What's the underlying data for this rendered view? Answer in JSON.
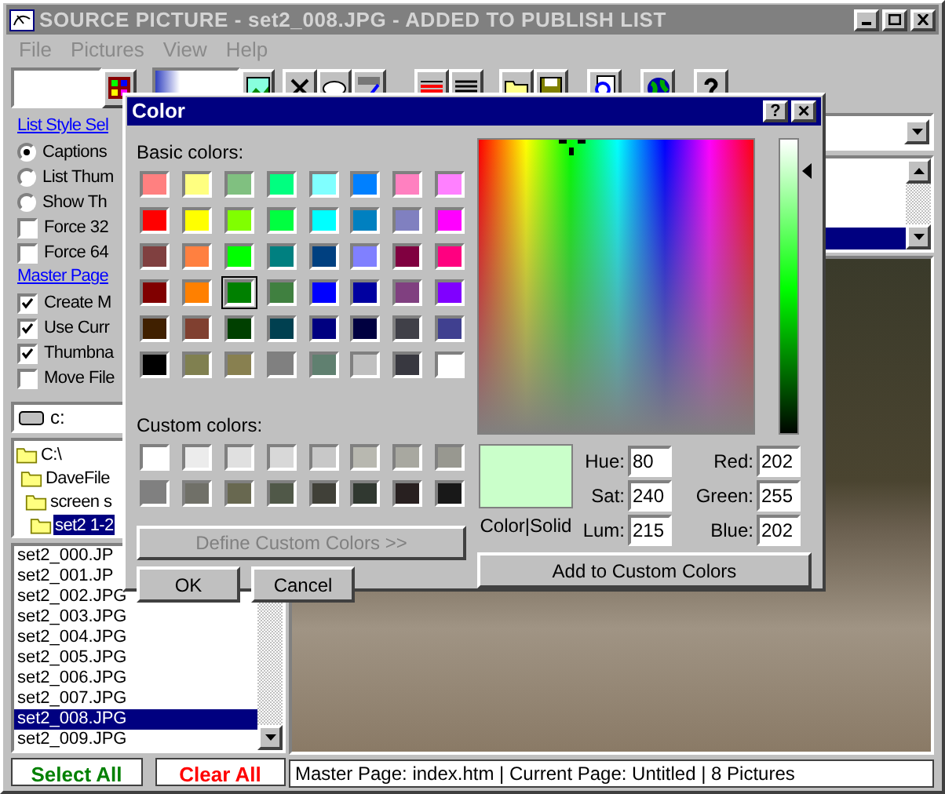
{
  "window": {
    "title": "SOURCE PICTURE - set2_008.JPG - ADDED TO PUBLISH LIST",
    "active": false
  },
  "menu": [
    "File",
    "Pictures",
    "View",
    "Help"
  ],
  "options": [
    {
      "kind": "link",
      "label": "List Style Sel"
    },
    {
      "kind": "radio",
      "label": "Captions",
      "selected": true
    },
    {
      "kind": "radio",
      "label": "List Thum",
      "selected": false
    },
    {
      "kind": "radio",
      "label": "Show Th",
      "selected": false
    },
    {
      "kind": "check",
      "label": "Force 32",
      "checked": false
    },
    {
      "kind": "check",
      "label": "Force 64",
      "checked": false
    },
    {
      "kind": "link",
      "label": "Master Page"
    },
    {
      "kind": "check",
      "label": "Create M",
      "checked": true
    },
    {
      "kind": "check",
      "label": "Use Curr",
      "checked": true
    },
    {
      "kind": "check",
      "label": "Thumbna",
      "checked": true
    },
    {
      "kind": "check",
      "label": "Move File",
      "checked": false
    }
  ],
  "drive": "c:",
  "folders": [
    {
      "label": "C:\\",
      "selected": false,
      "children": [
        {
          "label": "DaveFile",
          "selected": false,
          "children": [
            {
              "label": "screen s",
              "selected": false,
              "children": [
                {
                  "label": "set2 1-2",
                  "selected": true
                }
              ]
            }
          ]
        }
      ]
    }
  ],
  "files": [
    {
      "name": "set2_000.JP",
      "selected": false
    },
    {
      "name": "set2_001.JP",
      "selected": false
    },
    {
      "name": "set2_002.JPG",
      "selected": false
    },
    {
      "name": "set2_003.JPG",
      "selected": false
    },
    {
      "name": "set2_004.JPG",
      "selected": false
    },
    {
      "name": "set2_005.JPG",
      "selected": false
    },
    {
      "name": "set2_006.JPG",
      "selected": false
    },
    {
      "name": "set2_007.JPG",
      "selected": false
    },
    {
      "name": "set2_008.JPG",
      "selected": true
    },
    {
      "name": "set2_009.JPG",
      "selected": false
    }
  ],
  "buttons": {
    "select_all": "Select All",
    "clear_all": "Clear All"
  },
  "status_bar": "Master Page: index.htm | Current Page: Untitled | 8 Pictures",
  "color_dialog": {
    "title": "Color",
    "help": "?",
    "close": "×",
    "basic_label": "Basic colors:",
    "basic_colors": [
      {
        "color": "#ff8080",
        "selected": false
      },
      {
        "color": "#ffff80",
        "selected": false
      },
      {
        "color": "#80c080",
        "selected": false
      },
      {
        "color": "#00ff80",
        "selected": false
      },
      {
        "color": "#80ffff",
        "selected": false
      },
      {
        "color": "#0080ff",
        "selected": false
      },
      {
        "color": "#ff80c0",
        "selected": false
      },
      {
        "color": "#ff80ff",
        "selected": false
      },
      {
        "color": "#ff0000",
        "selected": false
      },
      {
        "color": "#ffff00",
        "selected": false
      },
      {
        "color": "#80ff00",
        "selected": false
      },
      {
        "color": "#00ff40",
        "selected": false
      },
      {
        "color": "#00ffff",
        "selected": false
      },
      {
        "color": "#0080c0",
        "selected": false
      },
      {
        "color": "#8080c0",
        "selected": false
      },
      {
        "color": "#ff00ff",
        "selected": false
      },
      {
        "color": "#804040",
        "selected": false
      },
      {
        "color": "#ff8040",
        "selected": false
      },
      {
        "color": "#00ff00",
        "selected": false
      },
      {
        "color": "#008080",
        "selected": false
      },
      {
        "color": "#004080",
        "selected": false
      },
      {
        "color": "#8080ff",
        "selected": false
      },
      {
        "color": "#800040",
        "selected": false
      },
      {
        "color": "#ff0080",
        "selected": false
      },
      {
        "color": "#800000",
        "selected": false
      },
      {
        "color": "#ff8000",
        "selected": false
      },
      {
        "color": "#008000",
        "selected": true
      },
      {
        "color": "#408040",
        "selected": false
      },
      {
        "color": "#0000ff",
        "selected": false
      },
      {
        "color": "#0000a0",
        "selected": false
      },
      {
        "color": "#804080",
        "selected": false
      },
      {
        "color": "#8000ff",
        "selected": false
      },
      {
        "color": "#402000",
        "selected": false
      },
      {
        "color": "#804030",
        "selected": false
      },
      {
        "color": "#004000",
        "selected": false
      },
      {
        "color": "#004050",
        "selected": false
      },
      {
        "color": "#000080",
        "selected": false
      },
      {
        "color": "#000040",
        "selected": false
      },
      {
        "color": "#404048",
        "selected": false
      },
      {
        "color": "#404090",
        "selected": false
      },
      {
        "color": "#000000",
        "selected": false
      },
      {
        "color": "#808050",
        "selected": false
      },
      {
        "color": "#888050",
        "selected": false
      },
      {
        "color": "#808080",
        "selected": false
      },
      {
        "color": "#608070",
        "selected": false
      },
      {
        "color": "#c0c0c0",
        "selected": false
      },
      {
        "color": "#383840",
        "selected": false
      },
      {
        "color": "#ffffff",
        "selected": false
      }
    ],
    "custom_label": "Custom colors:",
    "custom_colors": [
      {
        "color": "#ffffff"
      },
      {
        "color": "#ececec"
      },
      {
        "color": "#e0e0e0"
      },
      {
        "color": "#d8d8d8"
      },
      {
        "color": "#c8c8c8"
      },
      {
        "color": "#b8b8b0"
      },
      {
        "color": "#a8a8a0"
      },
      {
        "color": "#989890"
      },
      {
        "color": "#808080"
      },
      {
        "color": "#707068"
      },
      {
        "color": "#686850"
      },
      {
        "color": "#505848"
      },
      {
        "color": "#404038"
      },
      {
        "color": "#303830"
      },
      {
        "color": "#282020"
      },
      {
        "color": "#181818"
      }
    ],
    "define_button": {
      "label": "Define Custom Colors >>",
      "disabled": true
    },
    "ok": "OK",
    "cancel": "Cancel",
    "preview": {
      "color": "#caffca",
      "label": "Color|Solid"
    },
    "hsl": [
      {
        "label": "Hue:",
        "value": "80"
      },
      {
        "label": "Sat:",
        "value": "240"
      },
      {
        "label": "Lum:",
        "value": "215"
      }
    ],
    "rgb": [
      {
        "label": "Red:",
        "value": "202"
      },
      {
        "label": "Green:",
        "value": "255"
      },
      {
        "label": "Blue:",
        "value": "202"
      }
    ],
    "add_button": "Add to Custom Colors"
  }
}
